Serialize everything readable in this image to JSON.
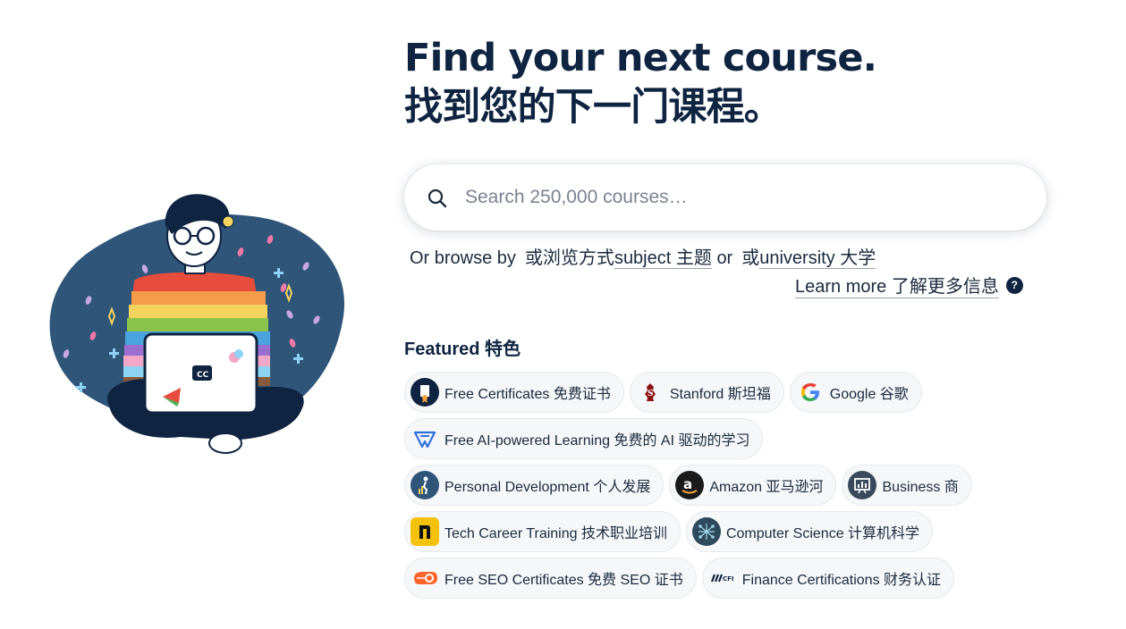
{
  "hero": {
    "title_en": "Find your next course.",
    "title_zh": "找到您的下一门课程。"
  },
  "search": {
    "placeholder": "Search 250,000 courses…"
  },
  "browse": {
    "prefix": "Or browse by",
    "prefix_zh": "或浏览方式",
    "subject_label": "subject 主题",
    "or_label": "or",
    "or_zh": "或",
    "university_label": "university 大学"
  },
  "learn_more": {
    "label": "Learn more 了解更多信息",
    "help_glyph": "?"
  },
  "featured": {
    "title": "Featured 特色",
    "rows": [
      [
        {
          "label": "Free Certificates 免费证书",
          "icon": "certificate-icon"
        },
        {
          "label": "Stanford 斯坦福",
          "icon": "stanford-logo-icon"
        },
        {
          "label": "Google 谷歌",
          "icon": "google-logo-icon"
        }
      ],
      [
        {
          "label": "Free AI-powered Learning 免费的 AI 驱动的学习",
          "icon": "ai-learning-icon"
        }
      ],
      [
        {
          "label": "Personal Development 个人发展",
          "icon": "personal-development-icon"
        },
        {
          "label": "Amazon 亚马逊河",
          "icon": "amazon-logo-icon"
        },
        {
          "label": "Business 商",
          "icon": "business-icon"
        }
      ],
      [
        {
          "label": "Tech Career Training 技术职业培训",
          "icon": "tech-career-icon"
        },
        {
          "label": "Computer Science 计算机科学",
          "icon": "computer-science-icon"
        }
      ],
      [
        {
          "label": "Free SEO Certificates 免费 SEO 证书",
          "icon": "semrush-logo-icon"
        },
        {
          "label": "Finance Certifications 财务认证",
          "icon": "cfi-logo-icon"
        }
      ]
    ]
  },
  "colors": {
    "heading": "#0e2440",
    "blob": "#2f5579",
    "chip_bg": "#f6f7f9"
  }
}
